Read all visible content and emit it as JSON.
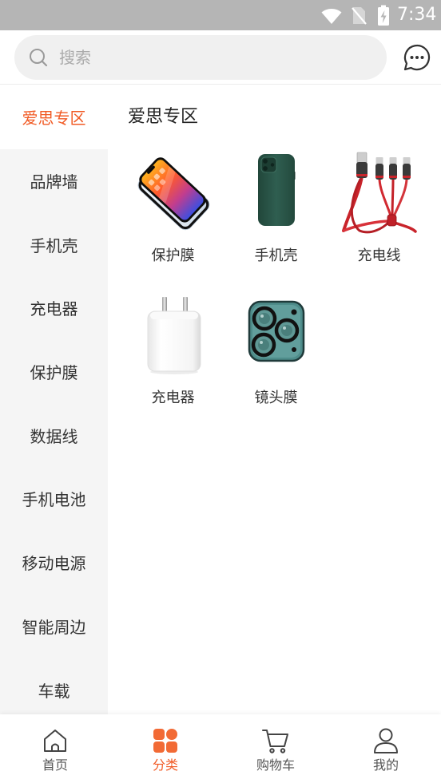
{
  "status_bar": {
    "time": "7:34",
    "icons": [
      "wifi-icon",
      "no-sim-icon",
      "battery-charging-icon"
    ]
  },
  "header": {
    "search": {
      "icon": "search-icon",
      "placeholder": "搜索"
    },
    "message_icon": "chat-bubble-icon"
  },
  "sidebar": {
    "items": [
      {
        "label": "爱思专区",
        "active": true
      },
      {
        "label": "品牌墙"
      },
      {
        "label": "手机壳"
      },
      {
        "label": "充电器"
      },
      {
        "label": "保护膜"
      },
      {
        "label": "数据线"
      },
      {
        "label": "手机电池"
      },
      {
        "label": "移动电源"
      },
      {
        "label": "智能周边"
      },
      {
        "label": "车载"
      }
    ]
  },
  "content": {
    "title": "爱思专区",
    "products": [
      {
        "label": "保护膜",
        "image": "screen-protector-image"
      },
      {
        "label": "手机壳",
        "image": "phone-case-image"
      },
      {
        "label": "充电线",
        "image": "charging-cable-image"
      },
      {
        "label": "充电器",
        "image": "charger-image"
      },
      {
        "label": "镜头膜",
        "image": "lens-film-image"
      }
    ]
  },
  "bottom_nav": {
    "items": [
      {
        "label": "首页",
        "icon": "home-icon"
      },
      {
        "label": "分类",
        "icon": "category-grid-icon",
        "active": true
      },
      {
        "label": "购物车",
        "icon": "cart-icon"
      },
      {
        "label": "我的",
        "icon": "user-icon"
      }
    ]
  },
  "colors": {
    "accent": "#f15a24",
    "status_bar": "#b5b5b5",
    "sidebar_background": "#f5f5f5",
    "search_background": "#f0f0f0",
    "text": "#333333"
  }
}
